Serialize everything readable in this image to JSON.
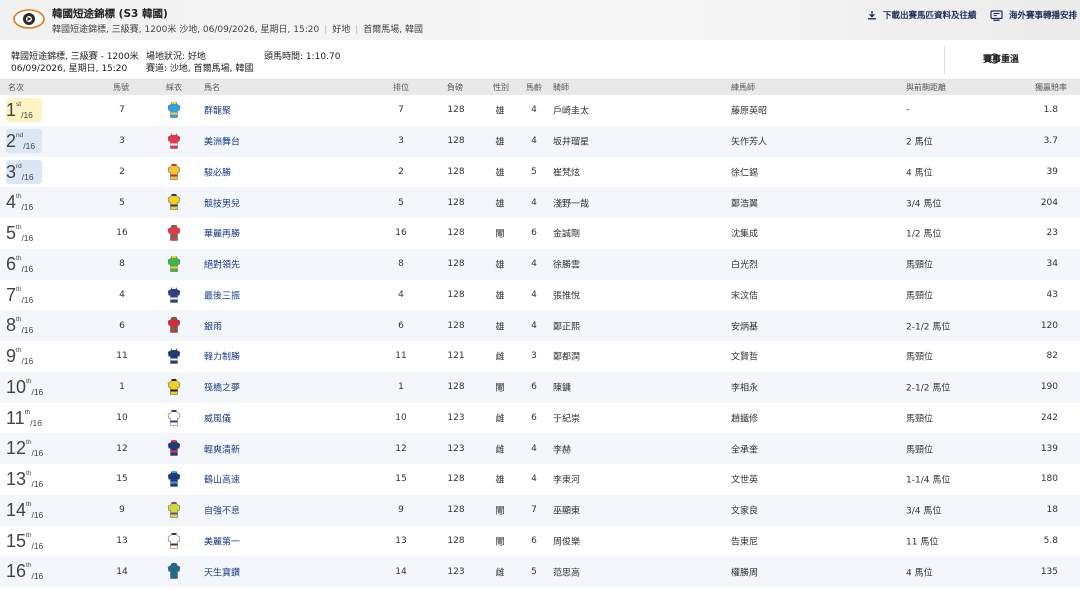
{
  "header": {
    "logo_icon": "eye-logo-icon",
    "title": "韓國短途錦標 (S3 韓國)",
    "sub_race": "韓國短途錦標, 三級賽, 1200米 沙地, 06/09/2026, 星期日, 15:20",
    "sub_going": "好地",
    "sub_venue": "首爾馬場, 韓國",
    "download_label": "下載出賽馬匹資料及往績",
    "overseas_label": "海外賽事轉播安排"
  },
  "info": {
    "race_line": "韓國短途錦標, 三級賽 - 1200米",
    "date_line": "06/09/2026, 星期日, 15:20",
    "going_line": "場地狀況: 好地",
    "track_line": "賽道: 沙地, 首爾馬場, 韓國",
    "time_line": "頭馬時間: 1:10.70",
    "replay_label": "賽事重溫"
  },
  "table": {
    "headers": {
      "place": "名次",
      "horse_no": "馬號",
      "silks": "綵衣",
      "horse": "馬名",
      "draw": "排位",
      "weight": "負磅",
      "sex": "性別",
      "age": "馬齡",
      "jockey": "騎師",
      "trainer": "練馬師",
      "margin": "與前駒距離",
      "odds": "獨贏賠率"
    },
    "rows": [
      {
        "place": "1",
        "suffix": "st",
        "total": "/16",
        "no": "7",
        "horse": "群龍聚",
        "draw": "7",
        "wt": "128",
        "sex": "雄",
        "age": "4",
        "jockey": "戶崎圭太",
        "trainer": "藤原英昭",
        "margin": "-",
        "odds": "1.8",
        "c1": "#2aa5e8",
        "c2": "#f5d21f"
      },
      {
        "place": "2",
        "suffix": "nd",
        "total": "/16",
        "no": "3",
        "horse": "美洲舞台",
        "draw": "3",
        "wt": "128",
        "sex": "雄",
        "age": "4",
        "jockey": "坂井瑠星",
        "trainer": "矢作芳人",
        "margin": "2 馬位",
        "odds": "3.7",
        "c1": "#e8354b",
        "c2": "#ffffff"
      },
      {
        "place": "3",
        "suffix": "rd",
        "total": "/16",
        "no": "2",
        "horse": "駿必勝",
        "draw": "2",
        "wt": "128",
        "sex": "雄",
        "age": "5",
        "jockey": "崔梵炫",
        "trainer": "徐仁錫",
        "margin": "4 馬位",
        "odds": "39",
        "c1": "#f2c531",
        "c2": "#c9302c"
      },
      {
        "place": "4",
        "suffix": "th",
        "total": "/16",
        "no": "5",
        "horse": "競技男兒",
        "draw": "5",
        "wt": "128",
        "sex": "雄",
        "age": "4",
        "jockey": "淺野一哉",
        "trainer": "鄭浩翼",
        "margin": "3/4 馬位",
        "odds": "204",
        "c1": "#f5d21f",
        "c2": "#1f3a7a"
      },
      {
        "place": "5",
        "suffix": "th",
        "total": "/16",
        "no": "16",
        "horse": "華麗再勝",
        "draw": "16",
        "wt": "128",
        "sex": "閹",
        "age": "6",
        "jockey": "金誠剛",
        "trainer": "沈集成",
        "margin": "1/2 馬位",
        "odds": "23",
        "c1": "#e8354b",
        "c2": "#2c8a3a"
      },
      {
        "place": "6",
        "suffix": "th",
        "total": "/16",
        "no": "8",
        "horse": "絕對領先",
        "draw": "8",
        "wt": "128",
        "sex": "雄",
        "age": "4",
        "jockey": "徐勝雲",
        "trainer": "白光烈",
        "margin": "馬頸位",
        "odds": "34",
        "c1": "#3fb54a",
        "c2": "#f5d21f"
      },
      {
        "place": "7",
        "suffix": "th",
        "total": "/16",
        "no": "4",
        "horse": "最後三振",
        "draw": "4",
        "wt": "128",
        "sex": "雄",
        "age": "4",
        "jockey": "張推悅",
        "trainer": "宋汶佶",
        "margin": "馬頸位",
        "odds": "43",
        "c1": "#2d3f8c",
        "c2": "#ffffff"
      },
      {
        "place": "8",
        "suffix": "th",
        "total": "/16",
        "no": "6",
        "horse": "銀雨",
        "draw": "6",
        "wt": "128",
        "sex": "雄",
        "age": "4",
        "jockey": "鄭正熙",
        "trainer": "安炳基",
        "margin": "2-1/2 馬位",
        "odds": "120",
        "c1": "#d62b3c",
        "c2": "#2c8a3a"
      },
      {
        "place": "9",
        "suffix": "th",
        "total": "/16",
        "no": "11",
        "horse": "韓力制勝",
        "draw": "11",
        "wt": "121",
        "sex": "雌",
        "age": "3",
        "jockey": "鄭都潤",
        "trainer": "文賢哲",
        "margin": "馬頸位",
        "odds": "82",
        "c1": "#1f3a7a",
        "c2": "#ffffff"
      },
      {
        "place": "10",
        "suffix": "th",
        "total": "/16",
        "no": "1",
        "horse": "筏橋之夢",
        "draw": "1",
        "wt": "128",
        "sex": "閹",
        "age": "6",
        "jockey": "陳鏞",
        "trainer": "李相永",
        "margin": "2-1/2 馬位",
        "odds": "190",
        "c1": "#f5d21f",
        "c2": "#222222"
      },
      {
        "place": "11",
        "suffix": "th",
        "total": "/16",
        "no": "10",
        "horse": "威風儀",
        "draw": "10",
        "wt": "123",
        "sex": "雌",
        "age": "6",
        "jockey": "于紀崇",
        "trainer": "趙鐵修",
        "margin": "馬頸位",
        "odds": "242",
        "c1": "#ffffff",
        "c2": "#2d3f8c"
      },
      {
        "place": "12",
        "suffix": "th",
        "total": "/16",
        "no": "12",
        "horse": "輕爽清新",
        "draw": "12",
        "wt": "123",
        "sex": "雌",
        "age": "4",
        "jockey": "李赫",
        "trainer": "全承奎",
        "margin": "馬頸位",
        "odds": "139",
        "c1": "#1f3a7a",
        "c2": "#e8354b"
      },
      {
        "place": "13",
        "suffix": "th",
        "total": "/16",
        "no": "15",
        "horse": "鶴山高速",
        "draw": "15",
        "wt": "128",
        "sex": "雄",
        "age": "4",
        "jockey": "李東河",
        "trainer": "文世英",
        "margin": "1-1/4 馬位",
        "odds": "180",
        "c1": "#1f3a7a",
        "c2": "#2aa5e8"
      },
      {
        "place": "14",
        "suffix": "th",
        "total": "/16",
        "no": "9",
        "horse": "自強不息",
        "draw": "9",
        "wt": "128",
        "sex": "閹",
        "age": "7",
        "jockey": "巫顯東",
        "trainer": "文家良",
        "margin": "3/4 馬位",
        "odds": "18",
        "c1": "#cddc39",
        "c2": "#7b3fa0"
      },
      {
        "place": "15",
        "suffix": "th",
        "total": "/16",
        "no": "13",
        "horse": "美麗第一",
        "draw": "13",
        "wt": "128",
        "sex": "閹",
        "age": "6",
        "jockey": "周俊樂",
        "trainer": "告東尼",
        "margin": "11 馬位",
        "odds": "5.8",
        "c1": "#ffffff",
        "c2": "#5a2a2a"
      },
      {
        "place": "16",
        "suffix": "th",
        "total": "/16",
        "no": "14",
        "horse": "天生寶鑽",
        "draw": "14",
        "wt": "123",
        "sex": "雌",
        "age": "5",
        "jockey": "范思高",
        "trainer": "權勝周",
        "margin": "4 馬位",
        "odds": "135",
        "c1": "#1e6b8a",
        "c2": "#1e6b8a"
      }
    ]
  },
  "colors": {
    "gold_highlight": "#fdf3c4",
    "silver_highlight": "#dbe7f5",
    "bronze_highlight": "#dbe7f5",
    "accent_navy": "#1b2d5a",
    "horse_link": "#1b3a8a"
  }
}
